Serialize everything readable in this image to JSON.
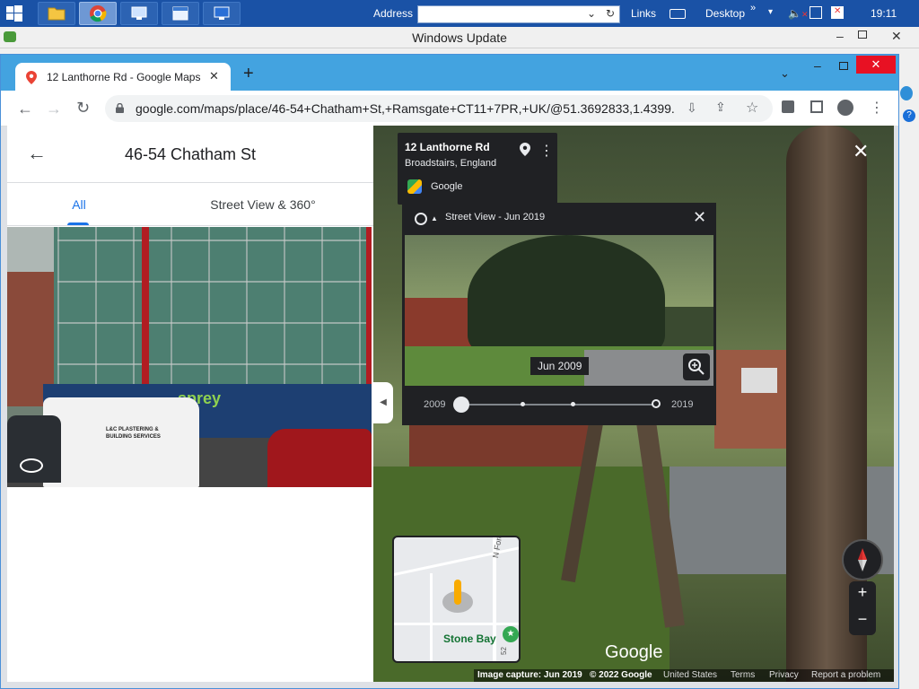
{
  "taskbar": {
    "address_label": "Address",
    "links_label": "Links",
    "desktop_label": "Desktop",
    "time": "19:11"
  },
  "wu_window": {
    "title": "Windows Update"
  },
  "chrome": {
    "tab_title": "12 Lanthorne Rd - Google Maps",
    "url": "google.com/maps/place/46-54+Chatham+St,+Ramsgate+CT11+7PR,+UK/@51.3692833,1.4399..."
  },
  "place_panel": {
    "title": "46-54 Chatham St",
    "tabs": [
      {
        "label": "All",
        "active": true
      },
      {
        "label": "Street View & 360°",
        "active": false
      }
    ],
    "signage": {
      "van_brand": "L&C PLASTERING & BUILDING SERVICES",
      "hoarding_text": "sprey"
    }
  },
  "streetview": {
    "address_title": "12 Lanthorne Rd",
    "address_subtitle": "Broadstairs, England",
    "provider": "Google",
    "timemachine": {
      "header": "Street View - Jun 2019",
      "preview_date": "Jun 2009",
      "start_year": "2009",
      "end_year": "2019"
    },
    "minimap": {
      "place_label": "Stone Bay",
      "road_label": "N Foreland",
      "road_number": "52"
    },
    "watermark": "Google",
    "footer": {
      "capture": "Image capture: Jun 2019",
      "copyright": "© 2022 Google",
      "country": "United States",
      "terms": "Terms",
      "privacy": "Privacy",
      "report": "Report a problem"
    },
    "zoom_in_label": "+",
    "zoom_out_label": "−"
  },
  "colors": {
    "taskbar": "#1a52a6",
    "chrome_frame": "#43a3e0",
    "accent": "#1a73e8",
    "dark_card": "#202124"
  }
}
